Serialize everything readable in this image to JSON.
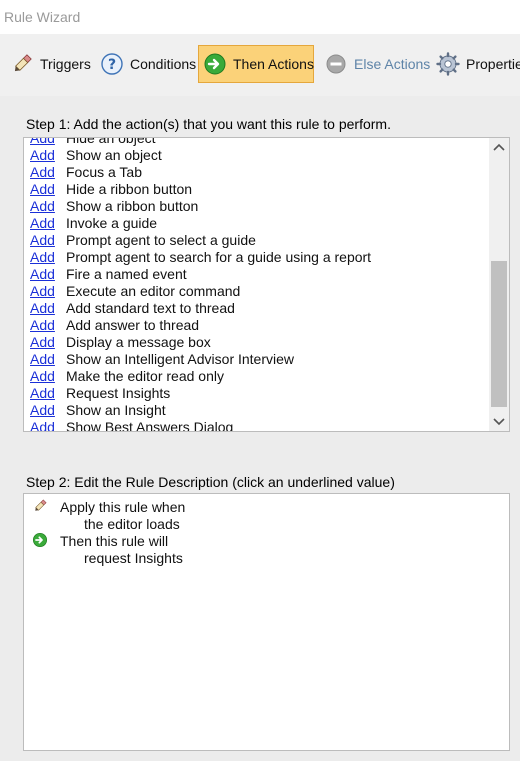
{
  "window": {
    "title": "Rule Wizard"
  },
  "tabs": [
    {
      "label": "Triggers",
      "icon": "pencil-eraser-icon",
      "state": "normal"
    },
    {
      "label": "Conditions",
      "icon": "question-icon",
      "state": "normal"
    },
    {
      "label": "Then Actions",
      "icon": "green-arrow-icon",
      "state": "active"
    },
    {
      "label": "Else Actions",
      "icon": "minus-circle-icon",
      "state": "disabled"
    },
    {
      "label": "Properties",
      "icon": "gear-icon",
      "state": "normal"
    }
  ],
  "step1": {
    "label": "Step 1:  Add the action(s) that you want this rule to perform.",
    "add_label": "Add",
    "actions": [
      "Hide an object",
      "Show an object",
      "Focus a Tab",
      "Hide a ribbon button",
      "Show a ribbon button",
      "Invoke a guide",
      "Prompt agent to select a guide",
      "Prompt agent to search for a guide using a report",
      "Fire a named event",
      "Execute an editor command",
      "Add standard text to thread",
      "Add answer to thread",
      "Display a message box",
      "Show an Intelligent Advisor Interview",
      "Make the editor read only",
      "Request Insights",
      "Show an Insight",
      "Show Best Answers Dialog"
    ]
  },
  "step2": {
    "label": "Step 2:  Edit the Rule Description (click an underlined value)",
    "lines": [
      {
        "text": "Apply this rule when",
        "icon": "pencil-eraser-icon"
      },
      {
        "text": "the editor loads",
        "icon": ""
      },
      {
        "text": "Then this rule will",
        "icon": "green-arrow-icon"
      },
      {
        "text": "request Insights",
        "icon": ""
      }
    ]
  },
  "colors": {
    "active_tab_bg": "#fbd279",
    "link": "#1a2fd8",
    "disabled_text": "#5e84a8"
  }
}
